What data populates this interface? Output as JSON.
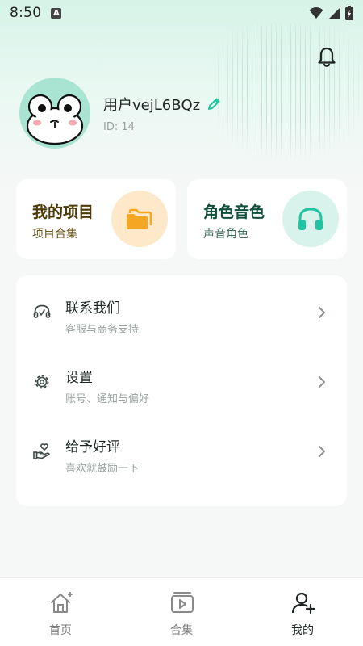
{
  "status_bar": {
    "time": "8:50",
    "notification_icon": "a-letter-icon",
    "icons": [
      "wifi-icon",
      "signal-icon",
      "battery-icon"
    ]
  },
  "header": {
    "bell_icon": "bell-icon"
  },
  "profile": {
    "username": "用户vejL6BQz",
    "user_id": "ID: 14",
    "edit_icon": "pencil-icon",
    "avatar_icon": "frog-avatar"
  },
  "cards": [
    {
      "title": "我的项目",
      "subtitle": "项目合集",
      "icon": "folder-icon",
      "accent": "#f5a623"
    },
    {
      "title": "角色音色",
      "subtitle": "声音角色",
      "icon": "headphones-icon",
      "accent": "#1fc5a2"
    }
  ],
  "menu": [
    {
      "title": "联系我们",
      "subtitle": "客服与商务支持",
      "icon": "headset-icon"
    },
    {
      "title": "设置",
      "subtitle": "账号、通知与偏好",
      "icon": "gear-icon"
    },
    {
      "title": "给予好评",
      "subtitle": "喜欢就鼓励一下",
      "icon": "hand-heart-icon"
    }
  ],
  "bottom_nav": [
    {
      "label": "首页",
      "icon": "home-plus-icon",
      "active": false
    },
    {
      "label": "合集",
      "icon": "video-collection-icon",
      "active": false
    },
    {
      "label": "我的",
      "icon": "user-plus-icon",
      "active": true
    }
  ],
  "colors": {
    "accent_green": "#1fc5a2",
    "accent_orange": "#f5a623",
    "header_mint": "#d6f3e8"
  }
}
